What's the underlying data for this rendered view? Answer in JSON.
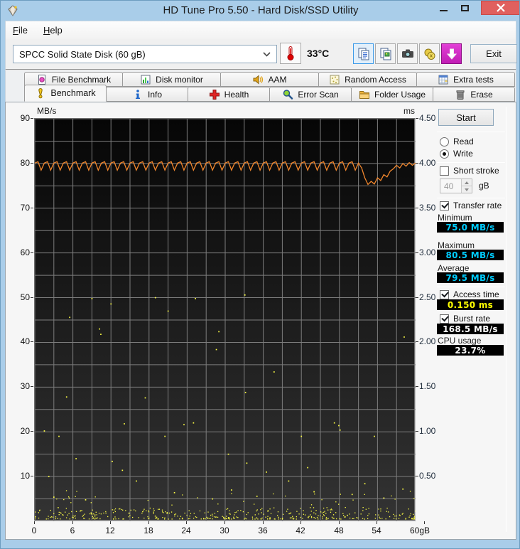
{
  "window": {
    "title": "HD Tune Pro 5.50 - Hard Disk/SSD Utility"
  },
  "menu": {
    "items": [
      {
        "label": "File"
      },
      {
        "label": "Help"
      }
    ]
  },
  "toolbar": {
    "device": "SPCC Solid State Disk (60 gB)",
    "temperature": "33°C",
    "exit_label": "Exit",
    "icons": [
      "copy-text",
      "copy-image",
      "camera",
      "coins",
      "down-arrow"
    ]
  },
  "tabs": {
    "row1": [
      {
        "label": "File Benchmark"
      },
      {
        "label": "Disk monitor"
      },
      {
        "label": "AAM"
      },
      {
        "label": "Random Access"
      },
      {
        "label": "Extra tests"
      }
    ],
    "row2": [
      {
        "label": "Benchmark",
        "active": true
      },
      {
        "label": "Info"
      },
      {
        "label": "Health"
      },
      {
        "label": "Error Scan"
      },
      {
        "label": "Folder Usage"
      },
      {
        "label": "Erase"
      }
    ]
  },
  "controls": {
    "start_label": "Start",
    "read_label": "Read",
    "write_label": "Write",
    "mode_selected": "write",
    "short_stroke_label": "Short stroke",
    "short_stroke_checked": false,
    "capacity_value": "40",
    "capacity_unit": "gB",
    "transfer_rate_label": "Transfer rate",
    "transfer_rate_checked": true,
    "minimum_label": "Minimum",
    "minimum_value": "75.0 MB/s",
    "maximum_label": "Maximum",
    "maximum_value": "80.5 MB/s",
    "average_label": "Average",
    "average_value": "79.5 MB/s",
    "access_time_label": "Access time",
    "access_time_checked": true,
    "access_time_value": "0.150 ms",
    "burst_rate_label": "Burst rate",
    "burst_rate_checked": true,
    "burst_rate_value": "168.5 MB/s",
    "cpu_usage_label": "CPU usage",
    "cpu_usage_value": "23.7%"
  },
  "colors": {
    "line_orange": "#f0862d",
    "scatter_yellow": "#ffff44",
    "grid_gray": "#7d7d7d",
    "value_cyan": "#00ccff",
    "value_yellow": "#ffff00",
    "value_white": "#ffffff",
    "titlebar_blue": "#a9cde9",
    "close_red": "#e0605e"
  },
  "chart_data": {
    "type": "line+scatter",
    "title": "HD Tune write benchmark",
    "grid": true,
    "x_axis": {
      "min": 0,
      "max": 60,
      "grid_step": 3,
      "ticks": [
        {
          "v": 0,
          "label": "0"
        },
        {
          "v": 6,
          "label": "6"
        },
        {
          "v": 12,
          "label": "12"
        },
        {
          "v": 18,
          "label": "18"
        },
        {
          "v": 24,
          "label": "24"
        },
        {
          "v": 30,
          "label": "30"
        },
        {
          "v": 36,
          "label": "36"
        },
        {
          "v": 42,
          "label": "42"
        },
        {
          "v": 48,
          "label": "48"
        },
        {
          "v": 54,
          "label": "54"
        },
        {
          "v": 60,
          "label": "60gB"
        }
      ]
    },
    "y_left_axis": {
      "label": "MB/s",
      "min": 0,
      "max": 90,
      "grid_step": 5,
      "ticks": [
        {
          "v": 90,
          "label": "90"
        },
        {
          "v": 80,
          "label": "80"
        },
        {
          "v": 70,
          "label": "70"
        },
        {
          "v": 60,
          "label": "60"
        },
        {
          "v": 50,
          "label": "50"
        },
        {
          "v": 40,
          "label": "40"
        },
        {
          "v": 30,
          "label": "30"
        },
        {
          "v": 20,
          "label": "20"
        },
        {
          "v": 10,
          "label": "10"
        }
      ]
    },
    "y_right_axis": {
      "label": "ms",
      "min": 0,
      "max": 4.5,
      "ticks": [
        {
          "v": 4.5,
          "label": "4.50"
        },
        {
          "v": 4.0,
          "label": "4.00"
        },
        {
          "v": 3.5,
          "label": "3.50"
        },
        {
          "v": 3.0,
          "label": "3.00"
        },
        {
          "v": 2.5,
          "label": "2.50"
        },
        {
          "v": 2.0,
          "label": "2.00"
        },
        {
          "v": 1.5,
          "label": "1.50"
        },
        {
          "v": 1.0,
          "label": "1.00"
        },
        {
          "v": 0.5,
          "label": "0.50"
        }
      ]
    },
    "transfer_rate_series": {
      "name": "Transfer rate (write)",
      "unit": "MB/s",
      "x_start": 0,
      "x_step": 0.5,
      "y": [
        80.1,
        80.4,
        78.5,
        80.1,
        80.4,
        78.5,
        80.1,
        80.4,
        78.5,
        80.1,
        80.4,
        78.5,
        80.1,
        80.4,
        78.5,
        80.1,
        80.4,
        78.5,
        80.1,
        80.4,
        78.5,
        80.1,
        80.4,
        78.5,
        80.1,
        80.4,
        78.5,
        80.1,
        80.4,
        78.5,
        80.1,
        80.4,
        78.5,
        80.1,
        80.4,
        78.5,
        80.1,
        80.4,
        78.5,
        80.1,
        80.4,
        78.5,
        80.1,
        80.4,
        78.5,
        80.1,
        80.4,
        78.5,
        80.1,
        80.4,
        78.5,
        80.1,
        80.4,
        78.5,
        80.1,
        80.4,
        78.5,
        80.1,
        80.4,
        78.5,
        80.1,
        80.4,
        78.5,
        80.1,
        80.4,
        78.5,
        80.1,
        80.4,
        78.5,
        80.1,
        80.4,
        78.5,
        80.1,
        80.4,
        78.5,
        80.1,
        80.4,
        78.5,
        80.1,
        80.4,
        78.5,
        80.1,
        80.4,
        78.5,
        80.1,
        80.4,
        78.5,
        80.1,
        80.4,
        78.5,
        80.1,
        80.4,
        78.5,
        80.1,
        80.4,
        78.5,
        80.1,
        80.4,
        78.5,
        80.1,
        80.4,
        78.5,
        80.1,
        79.0,
        76.8,
        75.3,
        76.0,
        75.4,
        76.8,
        76.2,
        77.5,
        77.0,
        78.3,
        78.8,
        79.6,
        79.0,
        80.0,
        79.4,
        80.2,
        79.6,
        80.1
      ]
    },
    "access_time_scatter": {
      "name": "Access time",
      "unit": "ms",
      "points": [
        [
          1.5,
          1.01
        ],
        [
          2.2,
          0.5
        ],
        [
          3.0,
          0.27
        ],
        [
          3.8,
          0.95
        ],
        [
          5.0,
          1.39
        ],
        [
          5.5,
          2.28
        ],
        [
          6.5,
          0.7
        ],
        [
          8.0,
          0.24
        ],
        [
          9.0,
          2.49
        ],
        [
          10.2,
          2.15
        ],
        [
          10.4,
          2.09
        ],
        [
          12.0,
          2.43
        ],
        [
          12.2,
          0.67
        ],
        [
          13.8,
          0.57
        ],
        [
          14.1,
          1.09
        ],
        [
          16.0,
          0.45
        ],
        [
          17.4,
          1.38
        ],
        [
          19.0,
          2.5
        ],
        [
          20.5,
          0.95
        ],
        [
          21.0,
          2.35
        ],
        [
          22.0,
          0.32
        ],
        [
          23.5,
          1.08
        ],
        [
          25.0,
          1.1
        ],
        [
          25.3,
          2.49
        ],
        [
          28.0,
          0.25
        ],
        [
          28.6,
          1.92
        ],
        [
          29.0,
          2.12
        ],
        [
          30.5,
          0.75
        ],
        [
          31.0,
          0.35
        ],
        [
          33.1,
          2.53
        ],
        [
          33.2,
          1.44
        ],
        [
          33.4,
          0.65
        ],
        [
          35.0,
          0.28
        ],
        [
          36.5,
          0.55
        ],
        [
          37.7,
          1.67
        ],
        [
          40.0,
          0.45
        ],
        [
          42.0,
          0.95
        ],
        [
          43.0,
          0.6
        ],
        [
          44.0,
          0.33
        ],
        [
          47.2,
          1.1
        ],
        [
          47.9,
          1.07
        ],
        [
          48.1,
          1.02
        ],
        [
          50.0,
          0.3
        ],
        [
          52.0,
          0.42
        ],
        [
          53.5,
          0.95
        ],
        [
          55.0,
          0.26
        ],
        [
          58.0,
          0.36
        ],
        [
          58.2,
          2.06
        ]
      ],
      "noise_band": {
        "count": 420,
        "ms_min": 0.025,
        "ms_max": 0.155,
        "seed": 7
      }
    }
  }
}
